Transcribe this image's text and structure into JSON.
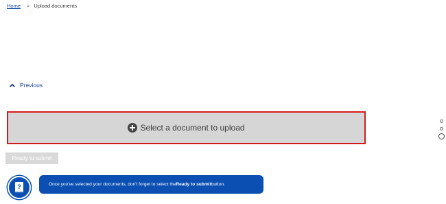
{
  "breadcrumb": {
    "home": "Home",
    "separator": ">",
    "current": "Upload documents"
  },
  "previous": {
    "label": "Previous",
    "icon": "chevron-up-icon"
  },
  "upload": {
    "label": "Select a document to upload",
    "icon": "plus-circle-icon",
    "border_color": "#d51a1f"
  },
  "submit": {
    "label": "Ready to submit"
  },
  "tip": {
    "icon": "question-book-icon",
    "text_before": "Once you've selected your documents, don't forget to select the ",
    "text_bold": "Ready to submit",
    "text_after": " button."
  },
  "pager": {
    "count": 3,
    "active_index": 2
  },
  "colors": {
    "accent_blue": "#0b4fb3",
    "link_blue": "#0b4aa2",
    "highlight_red": "#d51a1f"
  }
}
